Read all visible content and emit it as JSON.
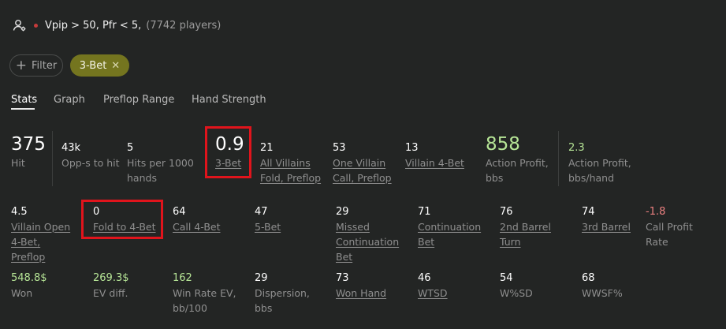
{
  "header": {
    "user_icon": "user-settings-icon",
    "title": "Vpip > 50, Pfr < 5,",
    "count": "(7742 players)"
  },
  "filters": {
    "add_label": "Filter",
    "active_chip": "3-Bet",
    "chip_color": "#74751f"
  },
  "tabs": [
    "Stats",
    "Graph",
    "Preflop Range",
    "Hand Strength"
  ],
  "active_tab": "Stats",
  "row1": [
    {
      "value": "375",
      "label": "Hit"
    },
    {
      "value": "43k",
      "label": "Opp-s to hit"
    },
    {
      "value": "5",
      "label_lines": [
        "Hits per 1000",
        "hands"
      ]
    },
    {
      "value": "0.9",
      "label": "3-Bet"
    },
    {
      "value": "21",
      "label_lines": [
        "All Villains",
        "Fold, Preflop"
      ]
    },
    {
      "value": "53",
      "label_lines": [
        "One Villain",
        "Call, Preflop"
      ]
    },
    {
      "value": "13",
      "label": "Villain 4-Bet"
    },
    {
      "value": "858",
      "label_lines": [
        "Action Profit,",
        "bbs"
      ]
    },
    {
      "value": "2.3",
      "label_lines": [
        "Action Profit,",
        "bbs/hand"
      ]
    }
  ],
  "row2": [
    {
      "value": "4.5",
      "label_lines": [
        "Villain Open",
        "4-Bet,",
        "Preflop"
      ]
    },
    {
      "value": "0",
      "label": "Fold to 4-Bet"
    },
    {
      "value": "64",
      "label": "Call 4-Bet"
    },
    {
      "value": "47",
      "label": "5-Bet"
    },
    {
      "value": "29",
      "label_lines": [
        "Missed",
        "Continuation",
        "Bet"
      ]
    },
    {
      "value": "71",
      "label_lines": [
        "Continuation",
        "Bet"
      ]
    },
    {
      "value": "76",
      "label_lines": [
        "2nd Barrel",
        "Turn"
      ]
    },
    {
      "value": "74",
      "label": "3rd Barrel"
    },
    {
      "value": "-1.8",
      "label_lines": [
        "Call Profit",
        "Rate"
      ]
    }
  ],
  "row3": [
    {
      "value": "548.8$",
      "label": "Won"
    },
    {
      "value": "269.3$",
      "label": "EV diff."
    },
    {
      "value": "162",
      "label_lines": [
        "Win Rate EV,",
        "bb/100"
      ]
    },
    {
      "value": "29",
      "label_lines": [
        "Dispersion,",
        "bbs"
      ]
    },
    {
      "value": "73",
      "label": "Won Hand"
    },
    {
      "value": "46",
      "label": "WTSD"
    },
    {
      "value": "54",
      "label": "W%SD"
    },
    {
      "value": "68",
      "label": "WWSF%"
    }
  ],
  "colors": {
    "background": "#232524",
    "positive": "#b6e596",
    "negative": "#ec8080",
    "highlight_box": "#e0141c"
  }
}
